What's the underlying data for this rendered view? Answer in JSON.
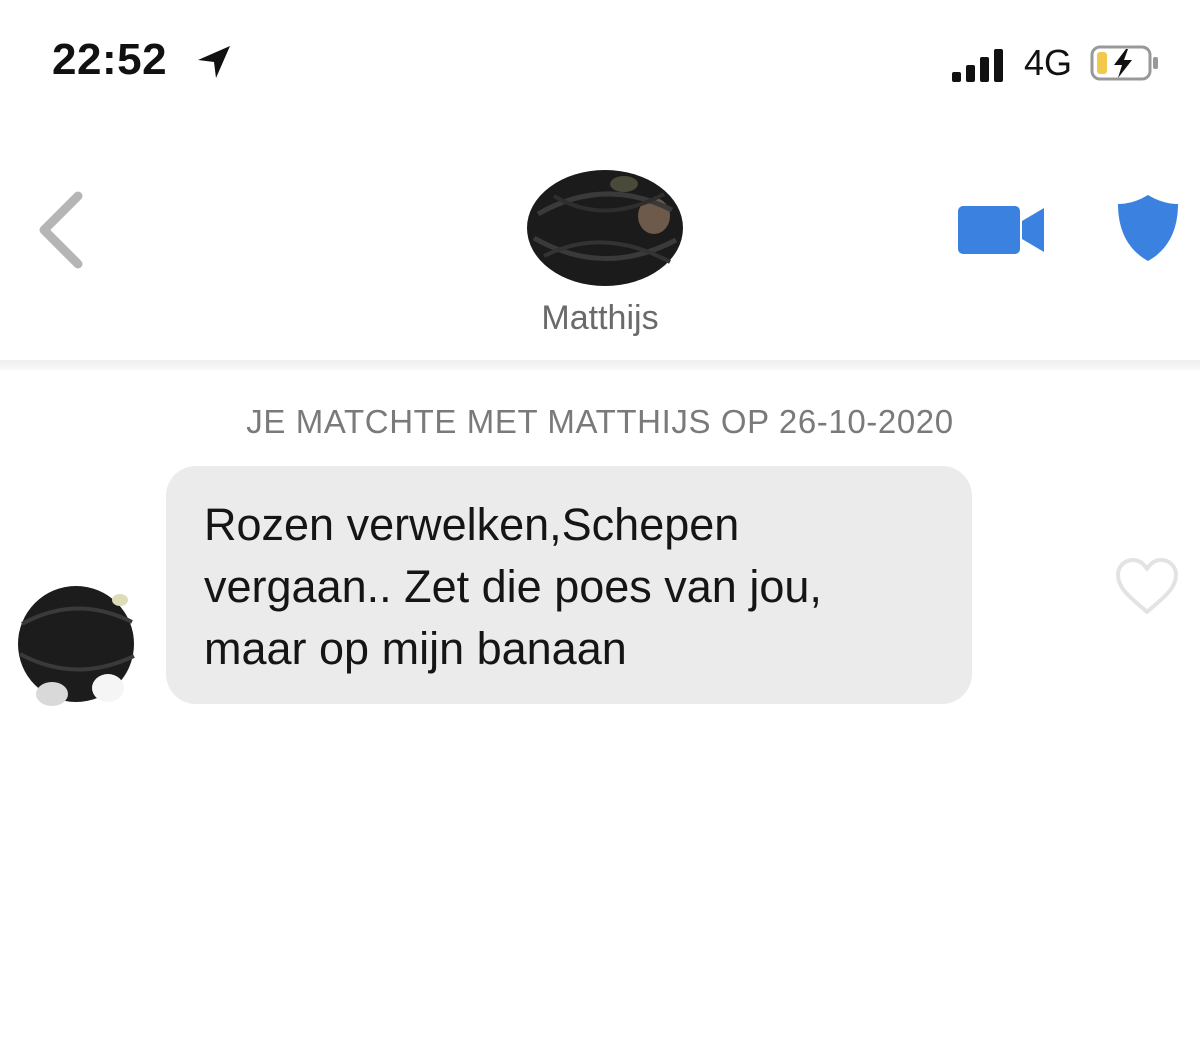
{
  "status_bar": {
    "time": "22:52",
    "network": "4G",
    "icons": [
      "location-arrow-icon",
      "signal-icon",
      "battery-charging-icon"
    ]
  },
  "header": {
    "match_name": "Matthijs",
    "icons": [
      "back-chevron-icon",
      "video-call-icon",
      "safety-shield-icon"
    ],
    "accent_color": "#3b82e0"
  },
  "chat": {
    "match_banner": "JE MATCHTE MET MATTHIJS OP 26-10-2020",
    "messages": [
      {
        "lines": [
          "Rozen verwelken,Schepen",
          "vergaan.. Zet die poes van jou,",
          "maar op mijn banaan"
        ],
        "bubble_color": "#ebebeb"
      }
    ]
  }
}
